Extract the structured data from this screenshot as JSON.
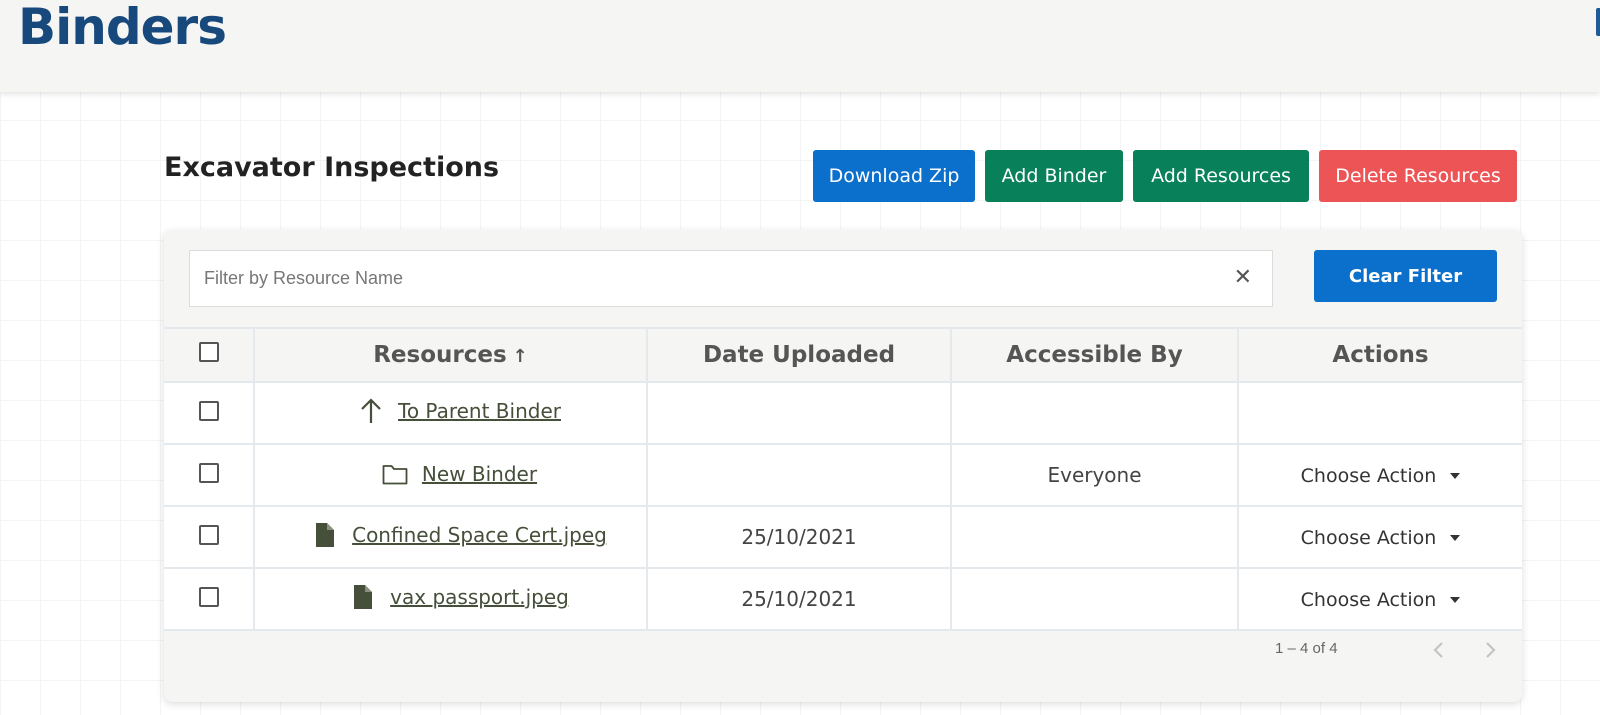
{
  "header": {
    "title": "Binders"
  },
  "section": {
    "title": "Excavator Inspections"
  },
  "toolbar": {
    "download_zip": "Download Zip",
    "add_binder": "Add Binder",
    "add_resources": "Add Resources",
    "delete_resources": "Delete Resources"
  },
  "filter": {
    "placeholder": "Filter by Resource Name",
    "value": "",
    "clear_icon": "close-icon",
    "clear_button": "Clear Filter"
  },
  "table": {
    "columns": {
      "resources": "Resources",
      "resources_sort": "↑",
      "date": "Date Uploaded",
      "access": "Accessible By",
      "actions": "Actions"
    },
    "rows": [
      {
        "icon": "arrow-up-icon",
        "name": "To Parent Binder",
        "date": "",
        "access": "",
        "action": ""
      },
      {
        "icon": "folder-icon",
        "name": "New Binder",
        "date": "",
        "access": "Everyone",
        "action": "Choose Action"
      },
      {
        "icon": "file-icon",
        "name": "Confined Space Cert.jpeg",
        "date": "25/10/2021",
        "access": "",
        "action": "Choose Action"
      },
      {
        "icon": "file-icon",
        "name": "vax passport.jpeg",
        "date": "25/10/2021",
        "access": "",
        "action": "Choose Action"
      }
    ]
  },
  "pagination": {
    "range": "1 – 4 of 4"
  },
  "colors": {
    "title": "#17497c",
    "primary": "#0b6fcc",
    "success": "#08805a",
    "danger": "#ec5456",
    "link": "#454f39"
  }
}
